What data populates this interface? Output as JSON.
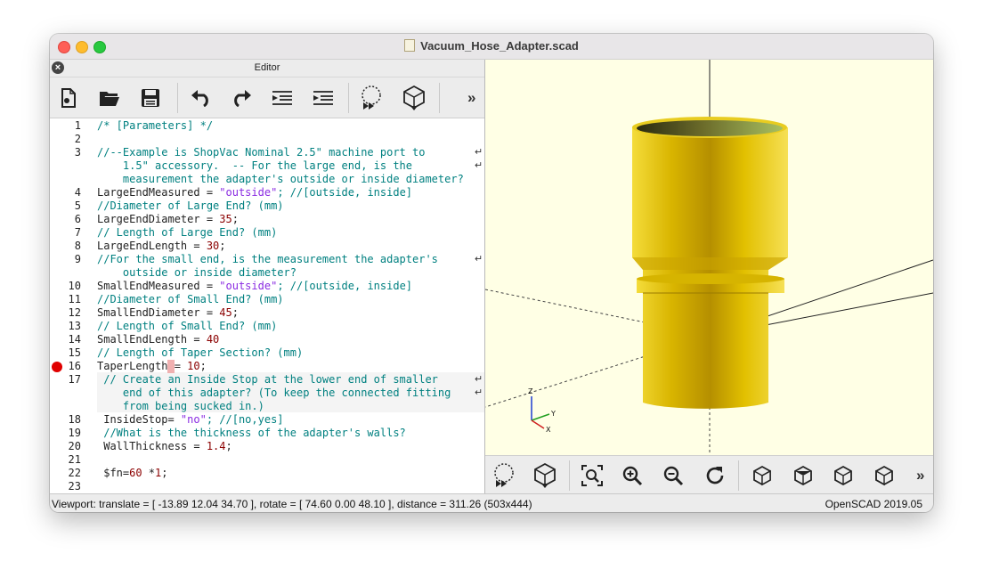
{
  "window": {
    "title": "Vacuum_Hose_Adapter.scad"
  },
  "editor": {
    "header_title": "Editor",
    "toolbar": [
      {
        "name": "new-file-icon"
      },
      {
        "name": "open-folder-icon"
      },
      {
        "name": "save-icon"
      },
      {
        "name": "undo-icon"
      },
      {
        "name": "redo-icon"
      },
      {
        "name": "unindent-icon"
      },
      {
        "name": "indent-icon"
      },
      {
        "name": "preview-icon"
      },
      {
        "name": "render-icon"
      },
      {
        "name": "more-icon"
      }
    ],
    "more_label": "»",
    "lines": [
      {
        "num": "1",
        "text": "/* [Parameters] */"
      },
      {
        "num": "2",
        "text": ""
      },
      {
        "num": "3",
        "text": "//--Example is ShopVac Nominal 2.5\" machine port to"
      },
      {
        "num": "",
        "text": "    1.5\" accessory.  -- For the large end, is the"
      },
      {
        "num": "",
        "text": "    measurement the adapter's outside or inside diameter?"
      },
      {
        "num": "4",
        "code": "LargeEndMeasured = ",
        "str": "\"outside\"",
        "rest": "; //[outside, inside]"
      },
      {
        "num": "5",
        "text": "//Diameter of Large End? (mm)"
      },
      {
        "num": "6",
        "code": "LargeEndDiameter = ",
        "num_val": "35",
        "rest": ";"
      },
      {
        "num": "7",
        "text": "// Length of Large End? (mm)"
      },
      {
        "num": "8",
        "code": "LargeEndLength = ",
        "num_val": "30",
        "rest": ";"
      },
      {
        "num": "9",
        "text": "//For the small end, is the measurement the adapter's"
      },
      {
        "num": "",
        "text": "    outside or inside diameter?"
      },
      {
        "num": "10",
        "code": "SmallEndMeasured = ",
        "str": "\"outside\"",
        "rest": "; //[outside, inside]"
      },
      {
        "num": "11",
        "text": "//Diameter of Small End? (mm)"
      },
      {
        "num": "12",
        "code": "SmallEndDiameter = ",
        "num_val": "45",
        "rest": ";"
      },
      {
        "num": "13",
        "text": "// Length of Small End? (mm)"
      },
      {
        "num": "14",
        "code": "SmallEndLength = ",
        "num_val": "40"
      },
      {
        "num": "15",
        "text": "// Length of Taper Section? (mm)"
      },
      {
        "num": "16",
        "code": "TaperLength",
        "marker": " ",
        "code2": "= ",
        "num_val": "10",
        "rest": ";"
      },
      {
        "num": "17",
        "text": " // Create an Inside Stop at the lower end of smaller"
      },
      {
        "num": "",
        "text": "    end of this adapter? (To keep the connected fitting"
      },
      {
        "num": "",
        "text": "    from being sucked in.)"
      },
      {
        "num": "18",
        "code": " InsideStop= ",
        "str": "\"no\"",
        "rest": "; //[no,yes]"
      },
      {
        "num": "19",
        "text": " //What is the thickness of the adapter's walls?"
      },
      {
        "num": "20",
        "code": " WallThickness = ",
        "num_val": "1.4",
        "rest": ";"
      },
      {
        "num": "21",
        "text": ""
      },
      {
        "num": "22",
        "code": " $fn=",
        "num_val": "60",
        "code2": " *",
        "num2": "1",
        "rest": ";"
      },
      {
        "num": "23",
        "text": ""
      }
    ]
  },
  "viewport_toolbar": [
    {
      "name": "preview-icon"
    },
    {
      "name": "render-icon"
    },
    {
      "name": "view-all-icon"
    },
    {
      "name": "zoom-in-icon"
    },
    {
      "name": "zoom-out-icon"
    },
    {
      "name": "reset-view-icon"
    },
    {
      "name": "view-right-icon"
    },
    {
      "name": "view-top-icon"
    },
    {
      "name": "view-bottom-icon"
    },
    {
      "name": "view-left-icon"
    },
    {
      "name": "more-icon"
    }
  ],
  "viewport_more_label": "»",
  "axis_labels": {
    "z": "Z",
    "y": "Y",
    "x": "X"
  },
  "status": {
    "left": "Viewport: translate = [ -13.89 12.04 34.70 ], rotate = [ 74.60 0.00 48.10 ], distance = 311.26 (503x444)",
    "right": "OpenSCAD 2019.05"
  },
  "colors": {
    "model": "#e6c000",
    "viewport_bg": "#ffffe5",
    "comment": "#008080",
    "string": "#8a2be2",
    "number": "#8b0000"
  }
}
